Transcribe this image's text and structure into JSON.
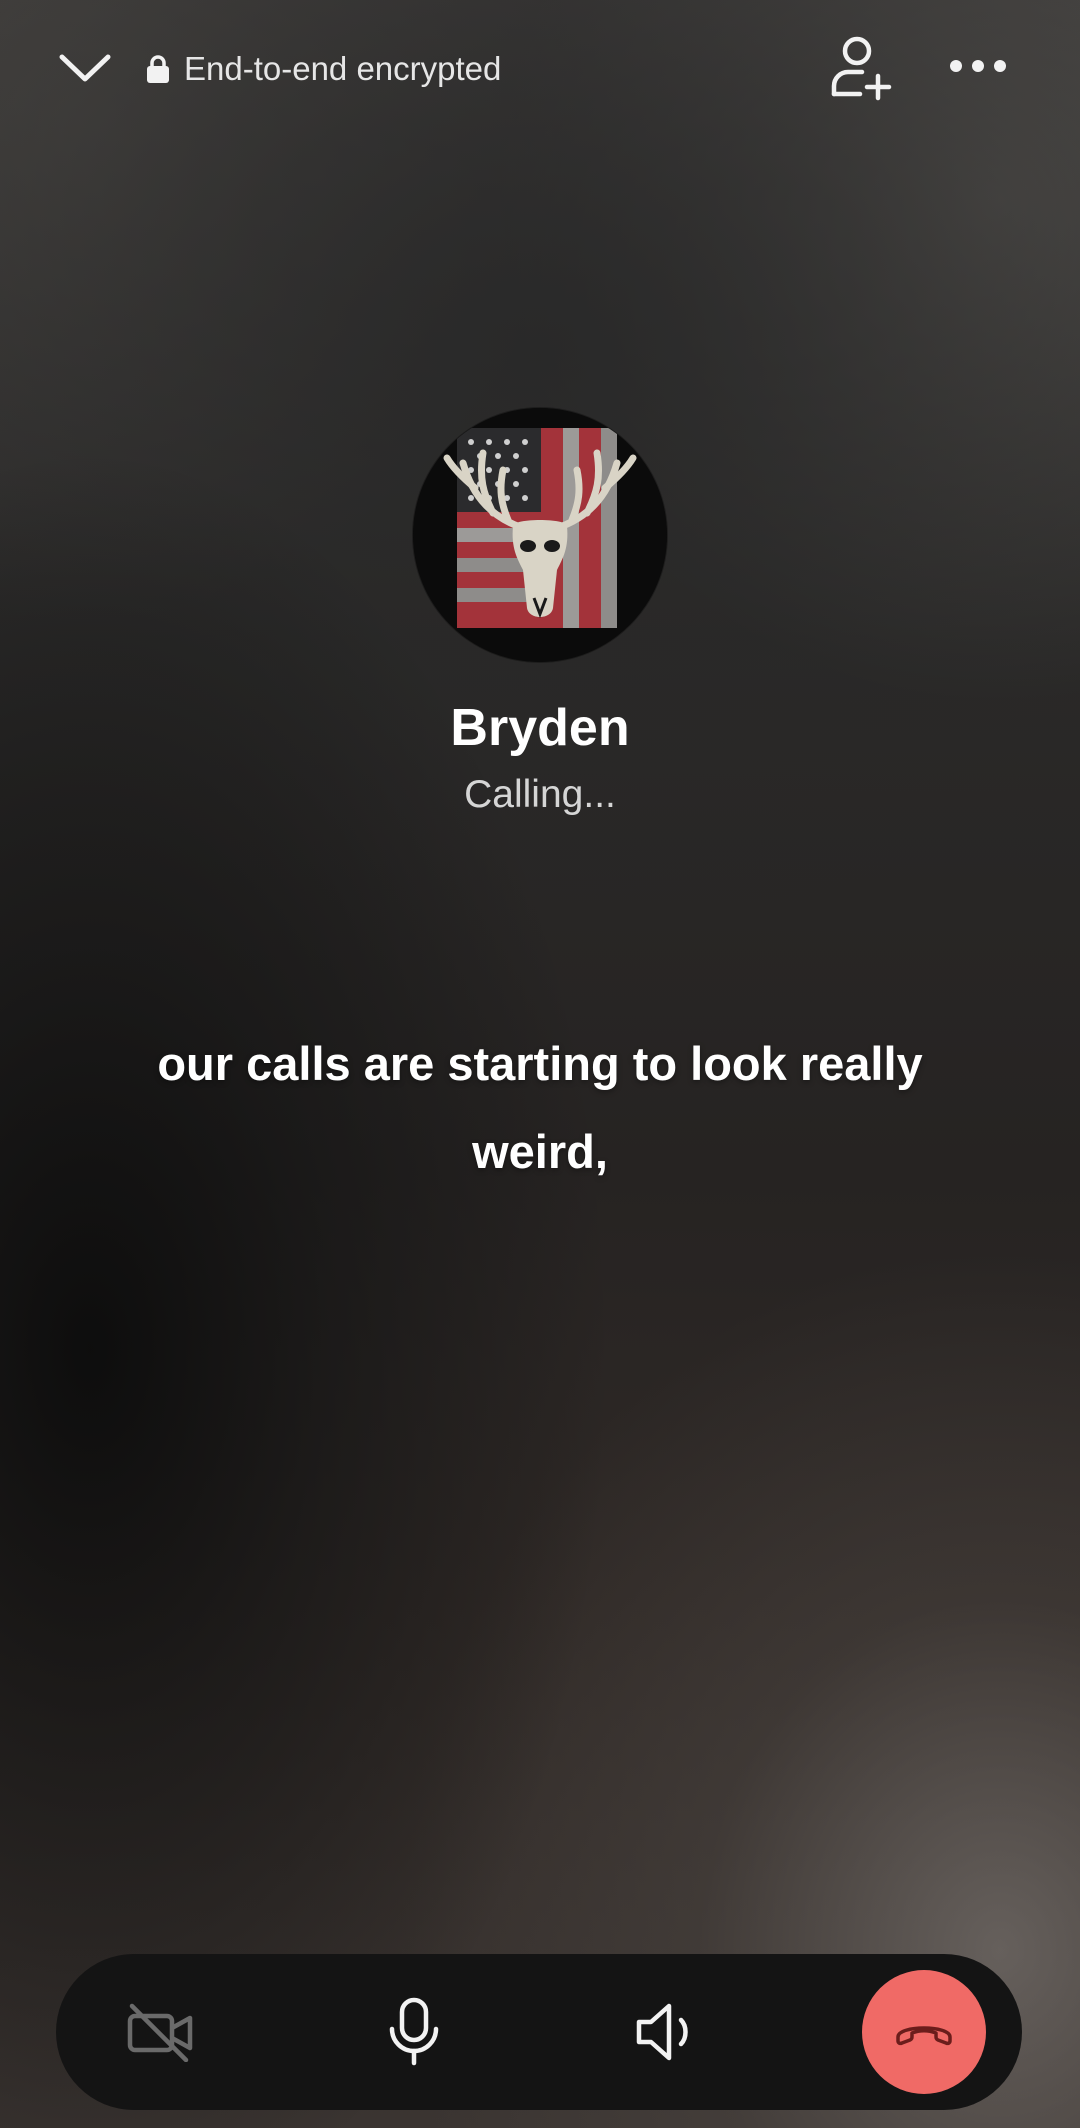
{
  "header": {
    "encryption_label": "End-to-end encrypted",
    "icons": {
      "collapse": "chevron-down-icon",
      "lock": "lock-icon",
      "add_person": "add-person-icon",
      "more": "more-horizontal-icon"
    }
  },
  "caller": {
    "name": "Bryden",
    "status": "Calling..."
  },
  "caption": {
    "text": "our calls are starting to look really weird,"
  },
  "controls": {
    "video": {
      "icon": "video-off-icon",
      "state": "off"
    },
    "microphone": {
      "icon": "microphone-icon",
      "state": "on"
    },
    "speaker": {
      "icon": "speaker-icon",
      "state": "on"
    },
    "end_call": {
      "icon": "phone-hangup-icon"
    }
  },
  "colors": {
    "end_call": "#f06a66",
    "control_bar": "#141414",
    "text_primary": "#ffffff",
    "text_secondary": "#d5d5d5"
  }
}
